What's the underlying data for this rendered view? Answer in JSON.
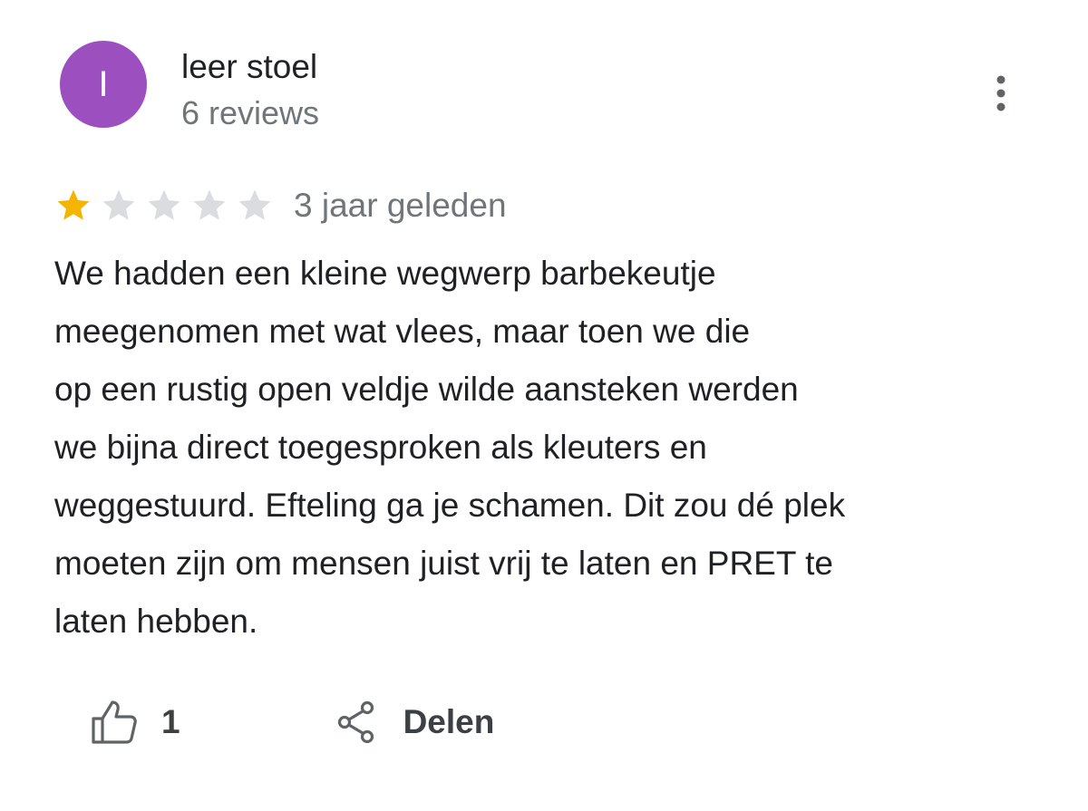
{
  "author": {
    "initial": "I",
    "name": "leer stoel",
    "reviews": "6 reviews",
    "avatar_color": "#9c4fbf"
  },
  "more_button": {
    "icon": "more-vert-icon"
  },
  "review": {
    "rating": 1,
    "max_rating": 5,
    "star_filled_color": "#f4b400",
    "star_empty_color": "#dadce0",
    "date": "3 jaar geleden",
    "text": "We hadden een kleine wegwerp barbekeutje\nmeegenomen met wat vlees, maar toen we die\nop een rustig open veldje wilde aansteken werden\nwe bijna direct toegesproken als kleuters en\nweggestuurd. Efteling ga je schamen. Dit zou dé plek\nmoeten zijn om mensen juist vrij te laten en PRET te\nlaten hebben."
  },
  "actions": {
    "like_icon": "thumb-up-icon",
    "like_count": "1",
    "share_icon": "share-icon",
    "share_label": "Delen"
  }
}
